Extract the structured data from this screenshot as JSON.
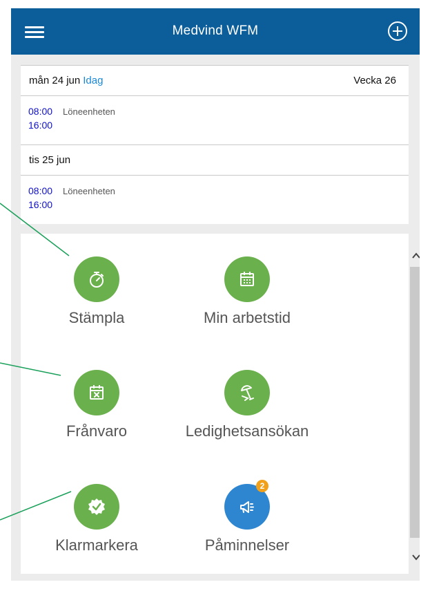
{
  "header": {
    "title": "Medvind WFM",
    "menu_icon": "hamburger-menu-icon",
    "add_icon": "plus-circle-icon"
  },
  "schedule": {
    "days": [
      {
        "label": "mån 24 jun",
        "today_label": "Idag",
        "week_label": "Vecka 26",
        "shift": {
          "start": "08:00",
          "end": "16:00",
          "unit": "Löneenheten"
        }
      },
      {
        "label": "tis 25 jun",
        "shift": {
          "start": "08:00",
          "end": "16:00",
          "unit": "Löneenheten"
        }
      }
    ]
  },
  "tiles": [
    {
      "label": "Stämpla",
      "icon": "stopwatch-icon",
      "color": "#6ab04c"
    },
    {
      "label": "Min arbetstid",
      "icon": "calendar-icon",
      "color": "#6ab04c"
    },
    {
      "label": "Frånvaro",
      "icon": "calendar-x-icon",
      "color": "#6ab04c"
    },
    {
      "label": "Ledighetsansökan",
      "icon": "beach-umbrella-icon",
      "color": "#6ab04c"
    },
    {
      "label": "Klarmarkera",
      "icon": "check-badge-icon",
      "color": "#6ab04c"
    },
    {
      "label": "Påminnelser",
      "icon": "megaphone-icon",
      "color": "#2f86d0",
      "badge": "2"
    }
  ],
  "colors": {
    "topbar": "#0b5e9a",
    "green": "#6ab04c",
    "blue": "#2f86d0",
    "today_link": "#1a88d6",
    "time_text": "#1010c8",
    "badge": "#f0a019",
    "callout_lines": "#1aa05a"
  }
}
